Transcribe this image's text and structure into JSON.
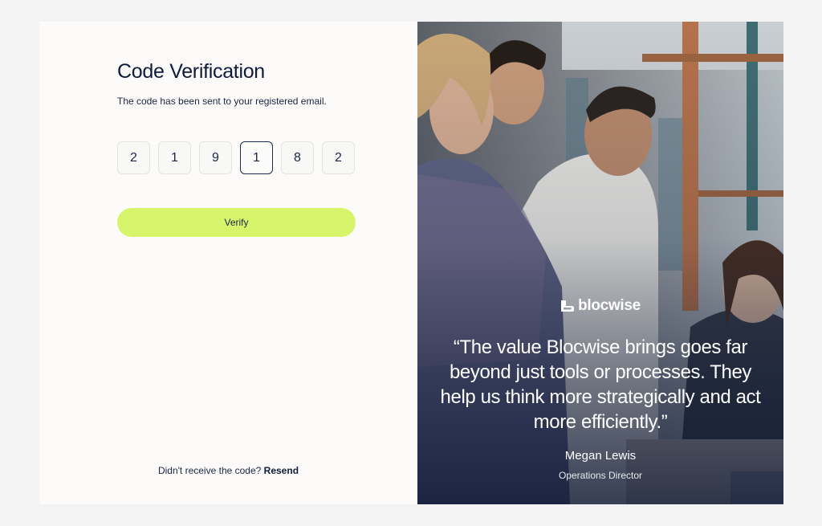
{
  "verification": {
    "title": "Code Verification",
    "subtitle": "The code has been sent to your registered email.",
    "digits": [
      "2",
      "1",
      "9",
      "1",
      "8",
      "2"
    ],
    "active_digit_index": 3,
    "verify_label": "Verify",
    "resend_prompt": "Didn't receive the code?",
    "resend_label": "Resend"
  },
  "testimonial": {
    "brand": "blocwise",
    "quote": "“The value Blocwise brings goes far beyond just tools or processes. They help us think more strategically and act more efficiently.”",
    "author_name": "Megan Lewis",
    "author_role": "Operations Director"
  },
  "colors": {
    "accent": "#d6f56b",
    "text_primary": "#0f1b3d",
    "panel_bg": "#fcfbf9",
    "page_bg": "#f3f3f3"
  }
}
